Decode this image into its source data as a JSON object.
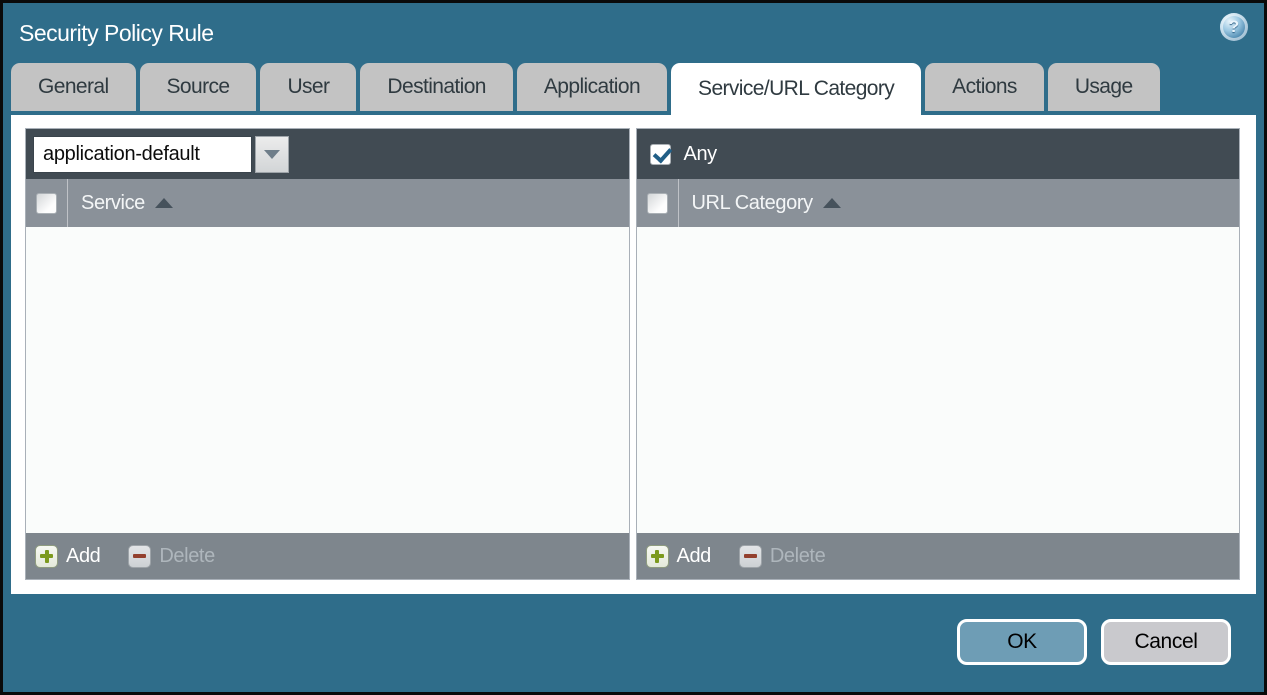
{
  "dialog": {
    "title": "Security Policy Rule",
    "help_icon_glyph": "?",
    "colors": {
      "background_teal": "#2F6D8A",
      "tab_inactive_bg": "#C3C3C3",
      "tab_active_bg": "#FFFFFF",
      "panel_toolbar_bg": "#414B53",
      "panel_header_bg": "#8A9199",
      "panel_footer_bg": "#7E868D",
      "add_plus_green": "#7C9A1D",
      "delete_minus_red": "#93402E",
      "ok_button_bg": "#6E9DB5",
      "cancel_button_bg": "#C9C9CD",
      "checkbox_check_blue": "#215E86"
    }
  },
  "tabs": [
    {
      "label": "General",
      "active": false
    },
    {
      "label": "Source",
      "active": false
    },
    {
      "label": "User",
      "active": false
    },
    {
      "label": "Destination",
      "active": false
    },
    {
      "label": "Application",
      "active": false
    },
    {
      "label": "Service/URL Category",
      "active": true
    },
    {
      "label": "Actions",
      "active": false
    },
    {
      "label": "Usage",
      "active": false
    }
  ],
  "service_panel": {
    "dropdown": {
      "value": "application-default"
    },
    "column_header": "Service",
    "sort_icon": "ascending-triangle",
    "rows": [],
    "add_label": "Add",
    "delete_label": "Delete",
    "delete_enabled": false
  },
  "url_category_panel": {
    "any_checkbox": {
      "label": "Any",
      "checked": true
    },
    "column_header": "URL Category",
    "sort_icon": "ascending-triangle",
    "rows": [],
    "add_label": "Add",
    "delete_label": "Delete",
    "delete_enabled": false
  },
  "footer": {
    "ok_label": "OK",
    "cancel_label": "Cancel"
  }
}
